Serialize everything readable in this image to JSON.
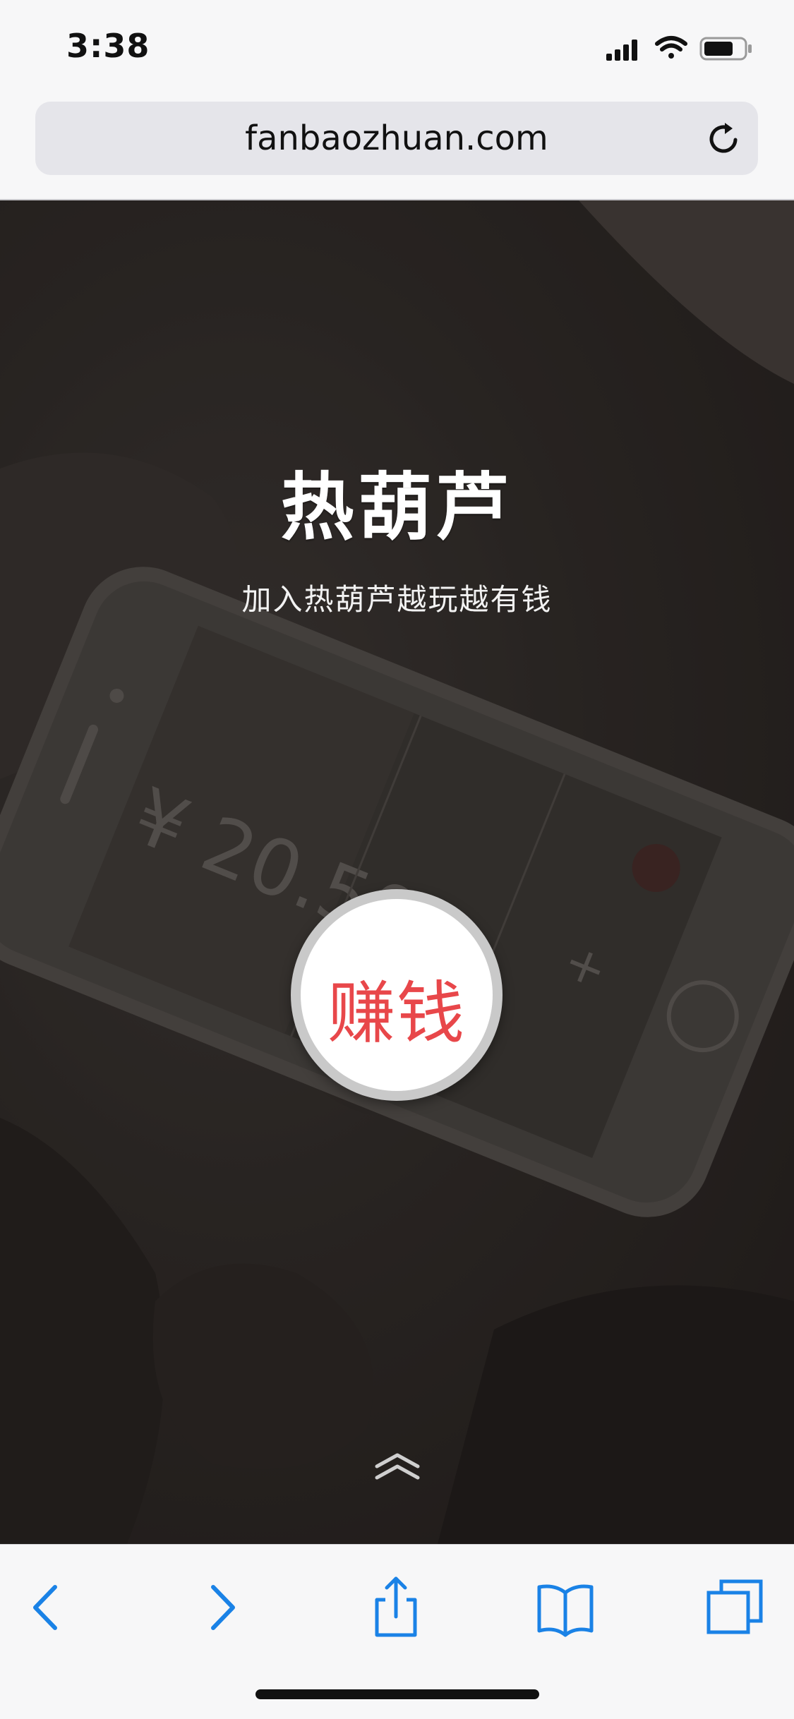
{
  "status_bar": {
    "time": "3:38",
    "icons": [
      "cellular-signal-icon",
      "wifi-icon",
      "battery-icon"
    ]
  },
  "browser": {
    "url": "fanbaozhuan.com",
    "reload_icon": "reload-icon"
  },
  "hero": {
    "title": "热葫芦",
    "subtitle": "加入热葫芦越玩越有钱",
    "earn_button_label": "赚钱",
    "scroll_icon": "chevron-double-up-icon"
  },
  "toolbar": {
    "items": [
      "back-icon",
      "forward-icon",
      "share-icon",
      "bookmarks-icon",
      "tabs-icon"
    ]
  },
  "colors": {
    "accent": "#e8474a",
    "toolbar_icon": "#1a82e6",
    "hero_bg": "#2f2a28"
  }
}
